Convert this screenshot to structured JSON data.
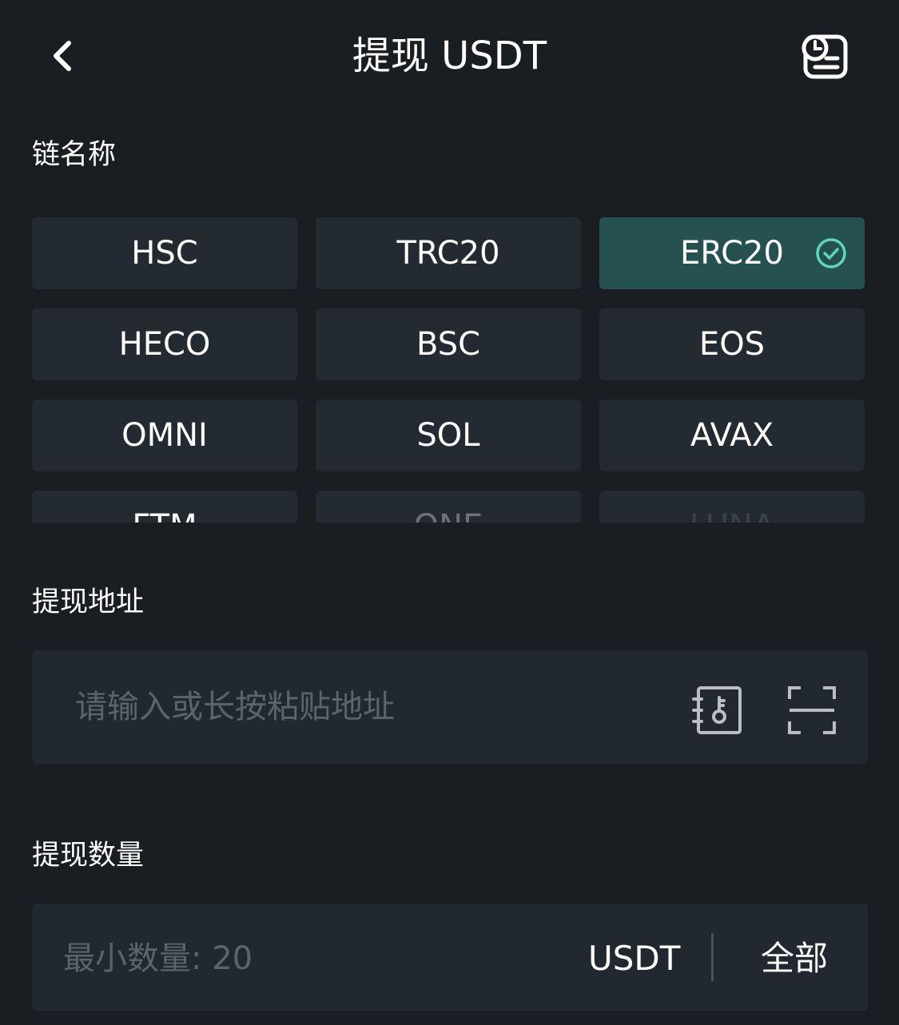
{
  "header": {
    "title": "提现 USDT",
    "back_icon": "chevron-left-icon",
    "history_icon": "history-record-icon"
  },
  "chain": {
    "label": "链名称",
    "options": [
      "HSC",
      "TRC20",
      "ERC20",
      "HECO",
      "BSC",
      "EOS",
      "OMNI",
      "SOL",
      "AVAX",
      "FTM",
      "ONE",
      "LUNA"
    ],
    "selected": "ERC20",
    "selected_icon": "check-circle-icon"
  },
  "address": {
    "label": "提现地址",
    "placeholder": "请输入或长按粘贴地址",
    "address_book_icon": "address-book-icon",
    "scan_icon": "scan-qr-icon"
  },
  "amount": {
    "label": "提现数量",
    "placeholder": "最小数量: 20",
    "unit": "USDT",
    "all_label": "全部"
  },
  "colors": {
    "background": "#1a1d21",
    "chip": "#232a31",
    "chip_selected": "#265151",
    "accent": "#5fd4c0",
    "placeholder": "#5c646b"
  }
}
